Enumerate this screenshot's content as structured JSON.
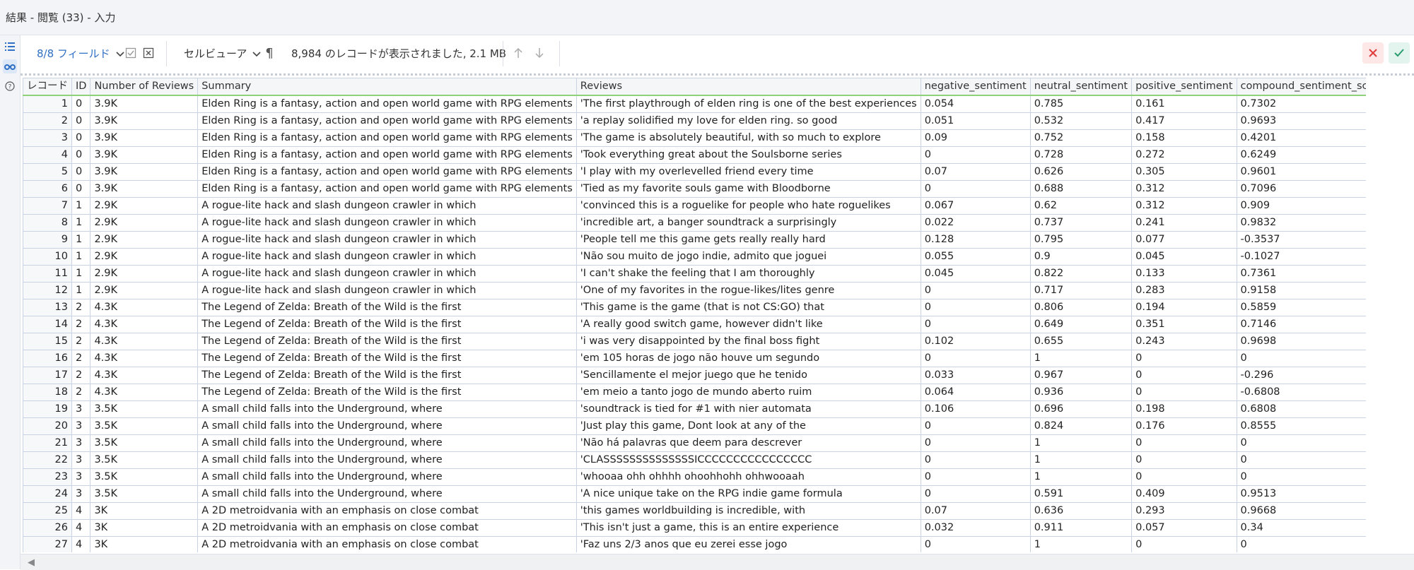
{
  "window": {
    "title": "結果 - 閲覧 (33) - 入力"
  },
  "toolbar": {
    "fields_label": "8/8 フィールド",
    "viewer_label": "セルビューア",
    "records_status": "8,984 のレコードが表示されました, 2.1 MB"
  },
  "table": {
    "columns": [
      "レコード",
      "ID",
      "Number of Reviews",
      "Summary",
      "Reviews",
      "negative_sentiment",
      "neutral_sentiment",
      "positive_sentiment",
      "compound_sentiment_score"
    ],
    "rows": [
      {
        "rec": "1",
        "id": "0",
        "num": "3.9K",
        "summary": "Elden Ring is a fantasy, action and open world game with RPG elements",
        "reviews": "'The first playthrough of elden ring is one of the best experiences",
        "neg": "0.054",
        "neu": "0.785",
        "pos": "0.161",
        "comp": "0.7302"
      },
      {
        "rec": "2",
        "id": "0",
        "num": "3.9K",
        "summary": "Elden Ring is a fantasy, action and open world game with RPG elements",
        "reviews": "'a replay solidified my love for elden ring. so good",
        "neg": "0.051",
        "neu": "0.532",
        "pos": "0.417",
        "comp": "0.9693"
      },
      {
        "rec": "3",
        "id": "0",
        "num": "3.9K",
        "summary": "Elden Ring is a fantasy, action and open world game with RPG elements",
        "reviews": "'The game is absolutely beautiful, with so much to explore",
        "neg": "0.09",
        "neu": "0.752",
        "pos": "0.158",
        "comp": "0.4201"
      },
      {
        "rec": "4",
        "id": "0",
        "num": "3.9K",
        "summary": "Elden Ring is a fantasy, action and open world game with RPG elements",
        "reviews": "'Took everything great about the Soulsborne series",
        "neg": "0",
        "neu": "0.728",
        "pos": "0.272",
        "comp": "0.6249"
      },
      {
        "rec": "5",
        "id": "0",
        "num": "3.9K",
        "summary": "Elden Ring is a fantasy, action and open world game with RPG elements",
        "reviews": "'I play with my overlevelled friend every time",
        "neg": "0.07",
        "neu": "0.626",
        "pos": "0.305",
        "comp": "0.9601"
      },
      {
        "rec": "6",
        "id": "0",
        "num": "3.9K",
        "summary": "Elden Ring is a fantasy, action and open world game with RPG elements",
        "reviews": "'Tied as my favorite souls game with Bloodborne",
        "neg": "0",
        "neu": "0.688",
        "pos": "0.312",
        "comp": "0.7096"
      },
      {
        "rec": "7",
        "id": "1",
        "num": "2.9K",
        "summary": "A rogue-lite hack and slash dungeon crawler in which",
        "reviews": "'convinced this is a roguelike for people who hate roguelikes",
        "neg": "0.067",
        "neu": "0.62",
        "pos": "0.312",
        "comp": "0.909"
      },
      {
        "rec": "8",
        "id": "1",
        "num": "2.9K",
        "summary": "A rogue-lite hack and slash dungeon crawler in which",
        "reviews": "'incredible art, a banger soundtrack a surprisingly",
        "neg": "0.022",
        "neu": "0.737",
        "pos": "0.241",
        "comp": "0.9832"
      },
      {
        "rec": "9",
        "id": "1",
        "num": "2.9K",
        "summary": "A rogue-lite hack and slash dungeon crawler in which",
        "reviews": "'People tell me this game gets really really hard",
        "neg": "0.128",
        "neu": "0.795",
        "pos": "0.077",
        "comp": "-0.3537"
      },
      {
        "rec": "10",
        "id": "1",
        "num": "2.9K",
        "summary": "A rogue-lite hack and slash dungeon crawler in which",
        "reviews": "'Não sou muito de jogo indie, admito que joguei",
        "neg": "0.055",
        "neu": "0.9",
        "pos": "0.045",
        "comp": "-0.1027"
      },
      {
        "rec": "11",
        "id": "1",
        "num": "2.9K",
        "summary": "A rogue-lite hack and slash dungeon crawler in which",
        "reviews": "'I can't shake the feeling that I am thoroughly",
        "neg": "0.045",
        "neu": "0.822",
        "pos": "0.133",
        "comp": "0.7361"
      },
      {
        "rec": "12",
        "id": "1",
        "num": "2.9K",
        "summary": "A rogue-lite hack and slash dungeon crawler in which",
        "reviews": "'One of my favorites in the rogue-likes/lites genre",
        "neg": "0",
        "neu": "0.717",
        "pos": "0.283",
        "comp": "0.9158"
      },
      {
        "rec": "13",
        "id": "2",
        "num": "4.3K",
        "summary": "The Legend of Zelda: Breath of the Wild is the first",
        "reviews": "'This game is the game (that is not CS:GO) that",
        "neg": "0",
        "neu": "0.806",
        "pos": "0.194",
        "comp": "0.5859"
      },
      {
        "rec": "14",
        "id": "2",
        "num": "4.3K",
        "summary": "The Legend of Zelda: Breath of the Wild is the first",
        "reviews": "'A really good switch game, however didn't like",
        "neg": "0",
        "neu": "0.649",
        "pos": "0.351",
        "comp": "0.7146"
      },
      {
        "rec": "15",
        "id": "2",
        "num": "4.3K",
        "summary": "The Legend of Zelda: Breath of the Wild is the first",
        "reviews": "'i was very disappointed by the final boss fight",
        "neg": "0.102",
        "neu": "0.655",
        "pos": "0.243",
        "comp": "0.9698"
      },
      {
        "rec": "16",
        "id": "2",
        "num": "4.3K",
        "summary": "The Legend of Zelda: Breath of the Wild is the first",
        "reviews": "'em 105 horas de jogo não houve um segundo",
        "neg": "0",
        "neu": "1",
        "pos": "0",
        "comp": "0"
      },
      {
        "rec": "17",
        "id": "2",
        "num": "4.3K",
        "summary": "The Legend of Zelda: Breath of the Wild is the first",
        "reviews": "'Sencillamente el mejor juego que he tenido",
        "neg": "0.033",
        "neu": "0.967",
        "pos": "0",
        "comp": "-0.296"
      },
      {
        "rec": "18",
        "id": "2",
        "num": "4.3K",
        "summary": "The Legend of Zelda: Breath of the Wild is the first",
        "reviews": "'em meio a tanto jogo de mundo aberto ruim",
        "neg": "0.064",
        "neu": "0.936",
        "pos": "0",
        "comp": "-0.6808"
      },
      {
        "rec": "19",
        "id": "3",
        "num": "3.5K",
        "summary": "A small child falls into the Underground, where",
        "reviews": "'soundtrack is tied for #1 with nier automata",
        "neg": "0.106",
        "neu": "0.696",
        "pos": "0.198",
        "comp": "0.6808"
      },
      {
        "rec": "20",
        "id": "3",
        "num": "3.5K",
        "summary": "A small child falls into the Underground, where",
        "reviews": "'Just play this game, Dont look at any of the",
        "neg": "0",
        "neu": "0.824",
        "pos": "0.176",
        "comp": "0.8555"
      },
      {
        "rec": "21",
        "id": "3",
        "num": "3.5K",
        "summary": "A small child falls into the Underground, where",
        "reviews": "'Não há palavras que deem para descrever",
        "neg": "0",
        "neu": "1",
        "pos": "0",
        "comp": "0"
      },
      {
        "rec": "22",
        "id": "3",
        "num": "3.5K",
        "summary": "A small child falls into the Underground, where",
        "reviews": "'CLASSSSSSSSSSSSSSICCCCCCCCCCCCCCCC",
        "neg": "0",
        "neu": "1",
        "pos": "0",
        "comp": "0"
      },
      {
        "rec": "23",
        "id": "3",
        "num": "3.5K",
        "summary": "A small child falls into the Underground, where",
        "reviews": "'whooaa ohh ohhhh ohoohhohh ohhwooaah",
        "neg": "0",
        "neu": "1",
        "pos": "0",
        "comp": "0"
      },
      {
        "rec": "24",
        "id": "3",
        "num": "3.5K",
        "summary": "A small child falls into the Underground, where",
        "reviews": "'A nice unique take on the RPG indie game formula",
        "neg": "0",
        "neu": "0.591",
        "pos": "0.409",
        "comp": "0.9513"
      },
      {
        "rec": "25",
        "id": "4",
        "num": "3K",
        "summary": "A 2D metroidvania with an emphasis on close combat",
        "reviews": "'this games worldbuilding is incredible, with",
        "neg": "0.07",
        "neu": "0.636",
        "pos": "0.293",
        "comp": "0.9668"
      },
      {
        "rec": "26",
        "id": "4",
        "num": "3K",
        "summary": "A 2D metroidvania with an emphasis on close combat",
        "reviews": "'This isn't just a game, this is an entire experience",
        "neg": "0.032",
        "neu": "0.911",
        "pos": "0.057",
        "comp": "0.34"
      },
      {
        "rec": "27",
        "id": "4",
        "num": "3K",
        "summary": "A 2D metroidvania with an emphasis on close combat",
        "reviews": "'Faz uns 2/3 anos que eu zerei esse jogo",
        "neg": "0",
        "neu": "1",
        "pos": "0",
        "comp": "0"
      }
    ]
  },
  "colors": {
    "accent": "#2f6fc4",
    "header_underline": "#8fd17a",
    "truncate_marker": "#e02020",
    "cancel": "#e03c3c",
    "confirm": "#2a9d6e"
  },
  "icons": [
    "list-icon",
    "binoculars-icon",
    "help-icon",
    "chevron-down-icon",
    "checkbox-icon",
    "clear-selection-icon",
    "pilcrow-icon",
    "arrow-up-icon",
    "arrow-down-icon",
    "close-icon",
    "check-icon",
    "scroll-left-icon"
  ]
}
